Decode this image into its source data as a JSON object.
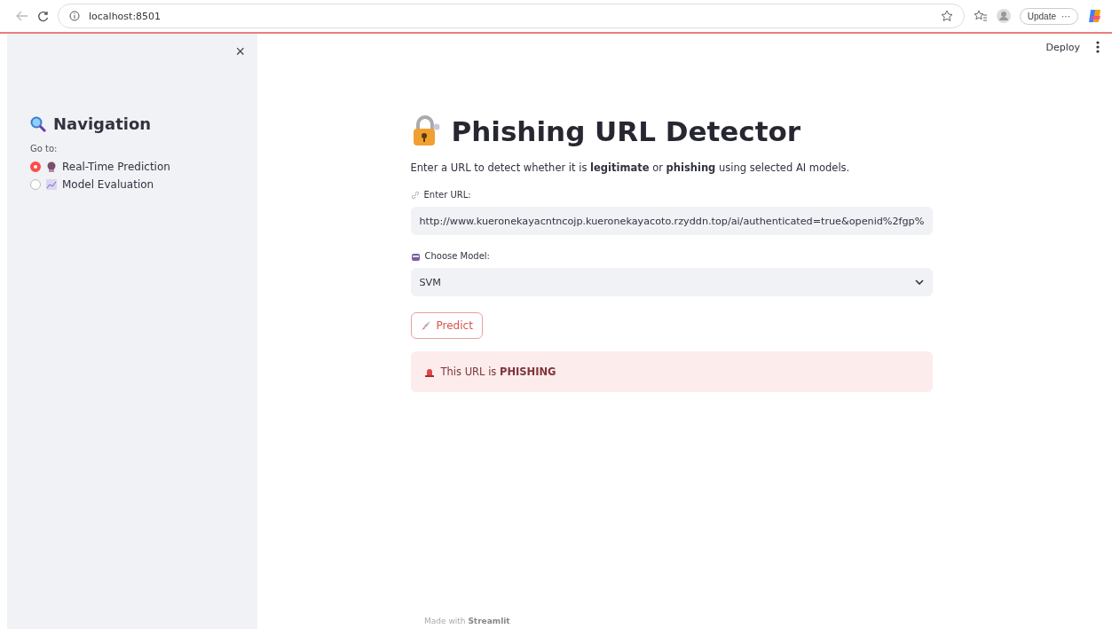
{
  "browser": {
    "address": "localhost:8501",
    "update_button": "Update",
    "update_more": "···"
  },
  "toolbar": {
    "deploy": "Deploy"
  },
  "sidebar": {
    "close": "×",
    "title": "Navigation",
    "radio_label": "Go to:",
    "options": [
      {
        "label": "Real-Time Prediction",
        "selected": true
      },
      {
        "label": "Model Evaluation",
        "selected": false
      }
    ]
  },
  "main": {
    "title": "Phishing URL Detector",
    "intro": "Enter a URL to detect whether it is **legitimate** or **phishing** using selected AI models.",
    "url_label": "Enter URL:",
    "url_value": "http://www.kueronekayacntncojp.kueronekayacoto.rzyddn.top/ai/authenticated=true&openid%2fgp%",
    "model_label": "Choose Model:",
    "model_value": "SVM",
    "predict_button": "Predict",
    "result": {
      "kind": "error",
      "text": "This URL is **PHISHING**"
    }
  },
  "footer": {
    "prefix": "Made with",
    "brand": "Streamlit"
  }
}
